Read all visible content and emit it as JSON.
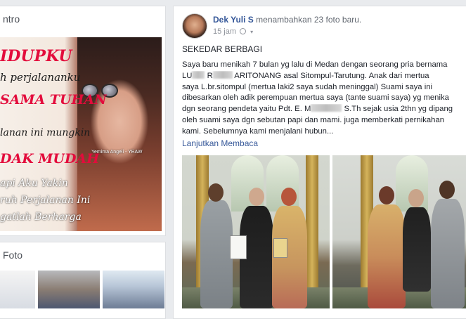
{
  "left": {
    "intro": {
      "title": "ntro",
      "cover": {
        "line1": "IDUPKU",
        "line2": "h perjalananku",
        "line3": "SAMA TUHAN",
        "line4": "lanan ini mungkin",
        "line5": "DAK MUDAH",
        "line6": "api Aku Yakin",
        "line7": "ruh Perjalanan Ini",
        "line8": "gatlah Berharga",
        "watermark": "Yemima Angeli - YEAW"
      }
    },
    "photos": {
      "title": "Foto"
    }
  },
  "post": {
    "author": "Dek Yuli S",
    "action": " menambahkan 23 foto baru.",
    "time": "15 jam",
    "title": "SEKEDAR BERBAGI",
    "body": {
      "l1": "Saya baru menikah 7 bulan yg lalu di Medan dengan seorang pria bernama",
      "l2a": "LU",
      "l2b": "R",
      "l2c": "ARITONANG asal Sitompul-Tarutung. Anak dari mertua",
      "l3": "saya L.br.sitompul (mertua laki2 saya sudah meninggal) Suami saya ini",
      "l4": "dibesarkan oleh adik perempuan mertua saya (tante suami saya) yg menika",
      "l5a": "dgn seorang pendeta yaitu Pdt. E. M",
      "l5b": "S.Th sejak usia 2thn yg dipang",
      "l6": "oleh suami saya dgn sebutan papi dan mami. juga memberkati pernikahan",
      "l7": "kami. Sebelumnya kami menjalani hubun..."
    },
    "read_more": "Lanjutkan Membaca"
  },
  "colors": {
    "link": "#365899",
    "background": "#e9ebee",
    "card": "#ffffff",
    "muted": "#90949c"
  },
  "icons": [
    "globe-icon",
    "chevron-down-icon"
  ]
}
